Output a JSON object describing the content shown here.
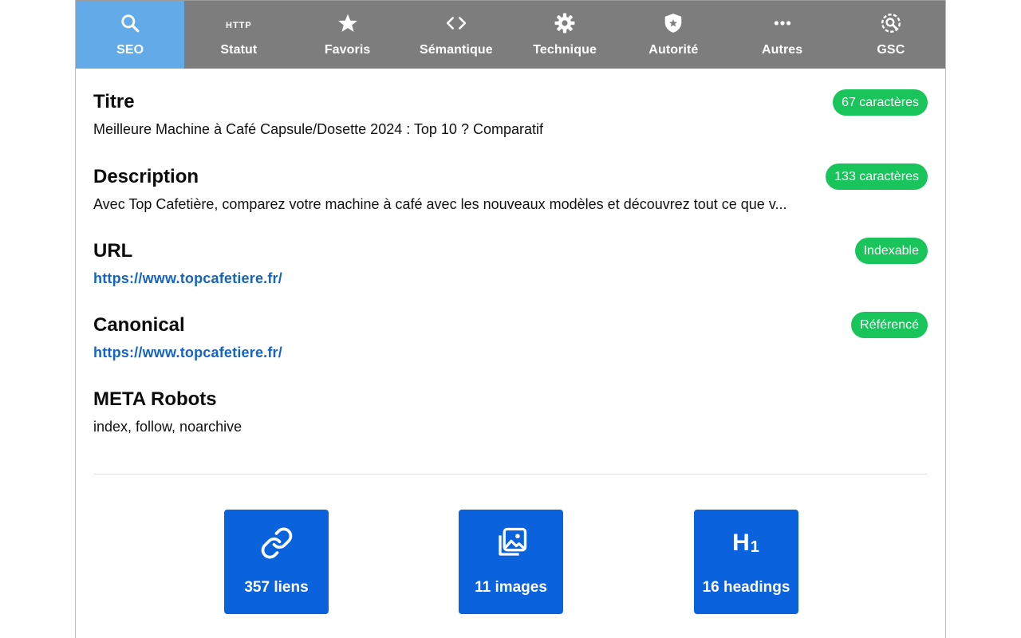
{
  "tabs": [
    {
      "label": "SEO",
      "icon": "search-icon",
      "active": true
    },
    {
      "label": "Statut",
      "icon": "http-icon",
      "icon_text": "HTTP"
    },
    {
      "label": "Favoris",
      "icon": "star-icon"
    },
    {
      "label": "Sémantique",
      "icon": "code-icon"
    },
    {
      "label": "Technique",
      "icon": "gear-icon"
    },
    {
      "label": "Autorité",
      "icon": "shield-icon"
    },
    {
      "label": "Autres",
      "icon": "ellipsis-icon"
    },
    {
      "label": "GSC",
      "icon": "search-console-icon"
    }
  ],
  "fields": {
    "title": {
      "label": "Titre",
      "value": "Meilleure Machine à Café Capsule/Dosette 2024 : Top 10 ? Comparatif",
      "badge": "67 caractères"
    },
    "description": {
      "label": "Description",
      "value": "Avec Top Cafetière, comparez votre machine à café avec les nouveaux modèles et découvrez tout ce que v...",
      "badge": "133 caractères"
    },
    "url": {
      "label": "URL",
      "value": "https://www.topcafetiere.fr/",
      "badge": "Indexable"
    },
    "canonical": {
      "label": "Canonical",
      "value": "https://www.topcafetiere.fr/",
      "badge": "Référencé"
    },
    "robots": {
      "label": "META Robots",
      "value": "index, follow, noarchive"
    }
  },
  "stats": {
    "links": {
      "label": "357 liens",
      "icon": "link-icon"
    },
    "images": {
      "label": "11 images",
      "icon": "images-icon"
    },
    "headings": {
      "label": "16 headings",
      "icon": "heading-icon",
      "icon_text": "H",
      "icon_sub": "1"
    }
  },
  "colors": {
    "tab_bar": "#7d7d7d",
    "tab_active": "#63abe8",
    "badge_green": "#19c45a",
    "link_blue": "#1565c0",
    "card_blue": "#0a63dd"
  }
}
